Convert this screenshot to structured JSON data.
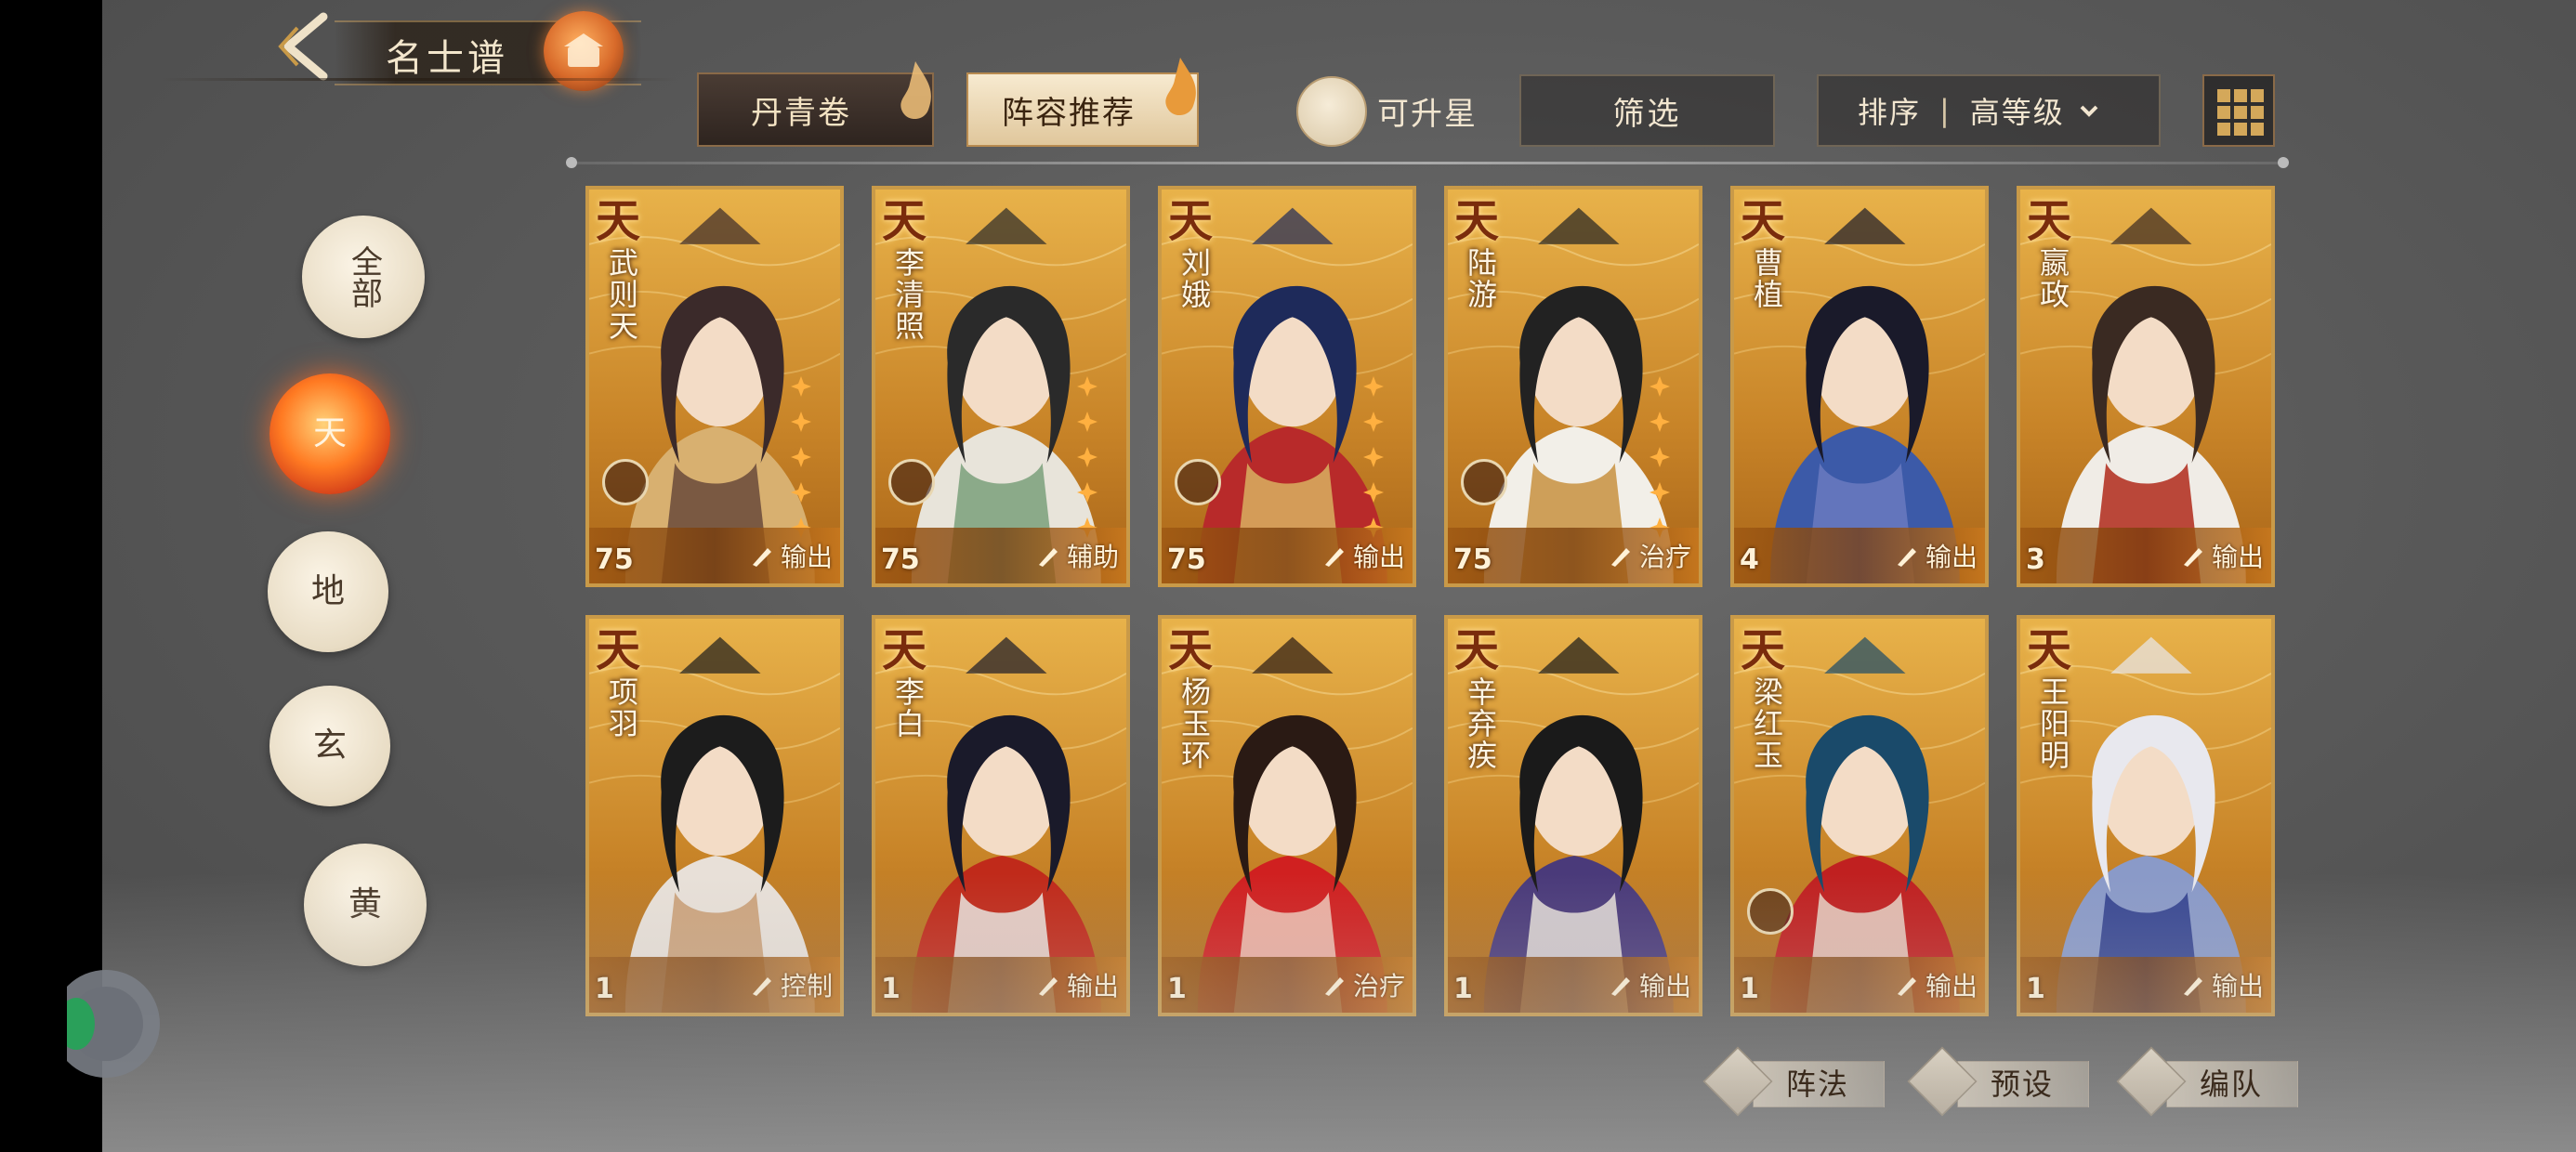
{
  "header": {
    "title": "名士谱"
  },
  "tabs": [
    {
      "label": "丹青卷",
      "active": false
    },
    {
      "label": "阵容推荐",
      "active": true
    }
  ],
  "toolbar": {
    "upgradable_label": "可升星",
    "filter_label": "筛选",
    "sort_label": "排序",
    "sort_separator": "|",
    "sort_value": "高等级"
  },
  "grades": [
    {
      "label": "全部",
      "active": false
    },
    {
      "label": "天",
      "active": true
    },
    {
      "label": "地",
      "active": false
    },
    {
      "label": "玄",
      "active": false
    },
    {
      "label": "黄",
      "active": false
    }
  ],
  "cards": [
    {
      "tier": "天",
      "name": "武则天",
      "level": "75",
      "role": "输出",
      "role_icon": "brush-icon",
      "palette": [
        "#3b2a2a",
        "#d8b070",
        "#6a4a3a"
      ]
    },
    {
      "tier": "天",
      "name": "李清照",
      "level": "75",
      "role": "辅助",
      "role_icon": "support-icon",
      "palette": [
        "#2a2a2a",
        "#e8e4da",
        "#7aa07a"
      ]
    },
    {
      "tier": "天",
      "name": "刘娥",
      "level": "75",
      "role": "输出",
      "role_icon": "brush-icon",
      "palette": [
        "#1e2a5a",
        "#b82a2a",
        "#d8b060"
      ]
    },
    {
      "tier": "天",
      "name": "陆游",
      "level": "75",
      "role": "治疗",
      "role_icon": "sprout-icon",
      "palette": [
        "#222222",
        "#f2efe8",
        "#c89040"
      ]
    },
    {
      "tier": "天",
      "name": "曹植",
      "level": "4",
      "role": "输出",
      "role_icon": "brush-icon",
      "palette": [
        "#1a1a2a",
        "#3c5aa8",
        "#6a7ac0"
      ]
    },
    {
      "tier": "天",
      "name": "嬴政",
      "level": "3",
      "role": "输出",
      "role_icon": "brush-icon",
      "palette": [
        "#3a2a22",
        "#f0ece6",
        "#b02a1a"
      ]
    },
    {
      "tier": "天",
      "name": "项羽",
      "level": "1",
      "role": "控制",
      "role_icon": "control-icon",
      "palette": [
        "#1c1c1c",
        "#e8e0d8",
        "#c89a70"
      ]
    },
    {
      "tier": "天",
      "name": "李白",
      "level": "1",
      "role": "输出",
      "role_icon": "brush-icon",
      "palette": [
        "#1a1a2a",
        "#c02a1a",
        "#eae6e0"
      ]
    },
    {
      "tier": "天",
      "name": "杨玉环",
      "level": "1",
      "role": "治疗",
      "role_icon": "sprout-icon",
      "palette": [
        "#2a1a14",
        "#d02020",
        "#f0c8b8"
      ]
    },
    {
      "tier": "天",
      "name": "辛弃疾",
      "level": "1",
      "role": "输出",
      "role_icon": "brush-icon",
      "palette": [
        "#1a1a1a",
        "#4a3a7a",
        "#e8e2da"
      ]
    },
    {
      "tier": "天",
      "name": "梁红玉",
      "level": "1",
      "role": "输出",
      "role_icon": "brush-icon",
      "palette": [
        "#1a4a6a",
        "#c02020",
        "#e8d6c8"
      ]
    },
    {
      "tier": "天",
      "name": "王阳明",
      "level": "1",
      "role": "输出",
      "role_icon": "brush-icon",
      "palette": [
        "#e8e8ee",
        "#8a9ac8",
        "#2a3a8a"
      ]
    }
  ],
  "bottom_actions": [
    {
      "label": "阵法",
      "icon": "formation-icon"
    },
    {
      "label": "预设",
      "icon": "preset-icon"
    },
    {
      "label": "编队",
      "icon": "team-icon"
    }
  ],
  "colors": {
    "accent": "#ff7a22",
    "card_border": "#c99a48",
    "gold": "#d4a85a"
  }
}
